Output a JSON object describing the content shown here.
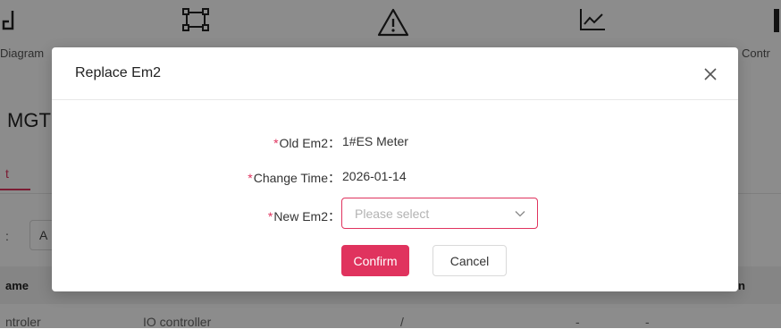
{
  "background": {
    "nav": [
      {
        "label": "Diagram",
        "icon": "diagram-icon"
      },
      {
        "label": "",
        "icon": "frame-icon"
      },
      {
        "label": "",
        "icon": "warning-icon"
      },
      {
        "label": "",
        "icon": "trend-chart-icon"
      },
      {
        "label": "Contr",
        "icon": "controller-icon"
      }
    ],
    "page_title": "MGT",
    "active_tab": "t",
    "filter_label": ":",
    "filter_value": "A",
    "table_headers": [
      "ame",
      "n"
    ],
    "row": {
      "name": "ntroler",
      "type": "IO controller",
      "col3": "/",
      "col4": "-",
      "col5": "-"
    }
  },
  "modal": {
    "title": "Replace Em2",
    "close_icon": "close-icon",
    "fields": {
      "old": {
        "label": "Old Em2：",
        "value": "1#ES Meter"
      },
      "time": {
        "label": "Change Time：",
        "value": "2026-01-14"
      },
      "new": {
        "label": "New Em2：",
        "placeholder": "Please select"
      }
    },
    "required_mark": "*",
    "confirm_label": "Confirm",
    "cancel_label": "Cancel"
  },
  "colors": {
    "accent": "#e0335e",
    "overlay": "rgba(0,0,0,0.45)"
  }
}
